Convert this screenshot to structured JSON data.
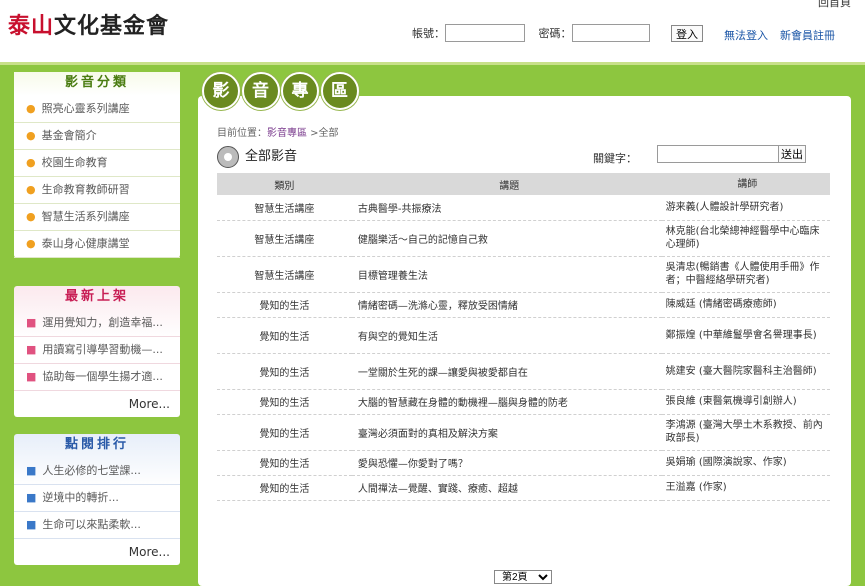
{
  "header": {
    "logo_red": "泰山",
    "logo_text": "泰山文化基金會",
    "homepage": "回首頁",
    "account_label": "帳號：",
    "password_label": "密碼：",
    "login_button": "登入",
    "cannot_login": "無法登入",
    "register": "新會員註冊"
  },
  "sidebar": {
    "av_category": {
      "title": "影音分類",
      "items": [
        "照亮心靈系列講座",
        "基金會簡介",
        "校園生命教育",
        "生命教育教師研習",
        "智慧生活系列講座",
        "泰山身心健康講堂"
      ]
    },
    "latest": {
      "title": "最新上架",
      "items": [
        "運用覺知力，創造幸福...",
        "用讀寫引導學習動機—...",
        "協助每一個學生揚才適..."
      ],
      "more": "More..."
    },
    "ranking": {
      "title": "點閱排行",
      "items": [
        "人生必修的七堂課...",
        "逆境中的轉折...",
        "生命可以來點柔軟..."
      ],
      "more": "More..."
    }
  },
  "main": {
    "tabs": [
      "影",
      "音",
      "專",
      "區"
    ],
    "breadcrumb_prefix": "目前位置：",
    "breadcrumb_current": "影音專區",
    "breadcrumb_suffix": " >全部",
    "section_title": "全部影音",
    "keyword_label": "關鍵字：",
    "search_button": "送出",
    "table": {
      "headers": [
        "類別",
        "講題",
        "講師"
      ],
      "rows": [
        {
          "category": "智慧生活講座",
          "topic": "古典醫學-共振療法",
          "speaker": "游来義(人體設計學研究者)"
        },
        {
          "category": "智慧生活講座",
          "topic": "健腦樂活～自己的記憶自己救",
          "speaker": "林克能(台北榮總神經醫學中心臨床心理師)"
        },
        {
          "category": "智慧生活講座",
          "topic": "目標管理養生法",
          "speaker": "吳清忠(暢銷書《人體使用手冊》作者；中醫經絡學研究者)"
        },
        {
          "category": "覺知的生活",
          "topic": "情緒密碼—洗滌心靈，釋放受困情緒",
          "speaker": "陳威廷 (情緒密碼療癒師)"
        },
        {
          "category": "覺知的生活",
          "topic": "有與空的覺知生活",
          "speaker": "鄭振煌 (中華維鬘學會名譽理事長)"
        },
        {
          "category": "覺知的生活",
          "topic": "一堂關於生死的課—讓愛與被愛都自在",
          "speaker": "姚建安 (臺大醫院家醫科主治醫師)"
        },
        {
          "category": "覺知的生活",
          "topic": "大腦的智慧藏在身體的動機裡—腦與身體的防老",
          "speaker": "張良維 (東醫氣機導引創辦人)"
        },
        {
          "category": "覺知的生活",
          "topic": "臺灣必須面對的真相及解決方案",
          "speaker": "李鴻源 (臺灣大學土木系教授、前內政部長)"
        },
        {
          "category": "覺知的生活",
          "topic": "愛與恐懼—你愛對了嗎？",
          "speaker": "吳娟瑜 (國際演說家、作家)"
        },
        {
          "category": "覺知的生活",
          "topic": "人間禪法—覺醒、實踐、療癒、超越",
          "speaker": "王溢嘉 (作家)"
        }
      ]
    },
    "pager_value": "第2頁"
  }
}
